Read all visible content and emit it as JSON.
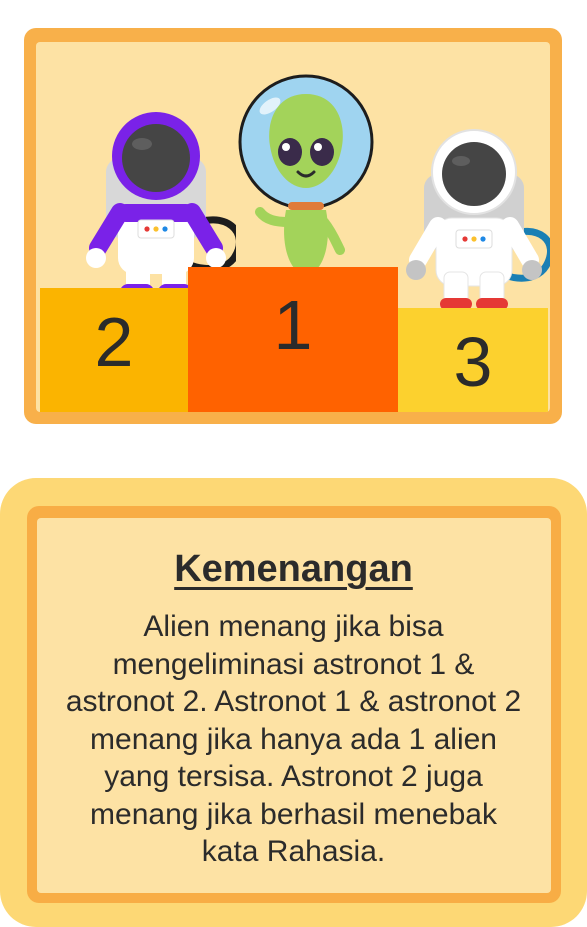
{
  "podium": {
    "places": [
      {
        "rank": "2",
        "character": "astronaut-purple"
      },
      {
        "rank": "1",
        "character": "alien"
      },
      {
        "rank": "3",
        "character": "astronaut-white"
      }
    ],
    "colors": {
      "card_border": "#f8b04a",
      "card_bg": "#fde2a4",
      "step_1": "#ff6200",
      "step_2": "#fbb400",
      "step_3": "#fcd12e"
    }
  },
  "rules": {
    "title": "Kemenangan",
    "lines": [
      "Alien menang jika bisa",
      "mengeliminasi astronot 1 &",
      "astronot 2. Astronot 1 & astronot 2",
      "menang jika hanya ada 1 alien",
      "yang tersisa. Astronot 2 juga",
      "menang jika berhasil menebak",
      "kata Rahasia."
    ]
  }
}
